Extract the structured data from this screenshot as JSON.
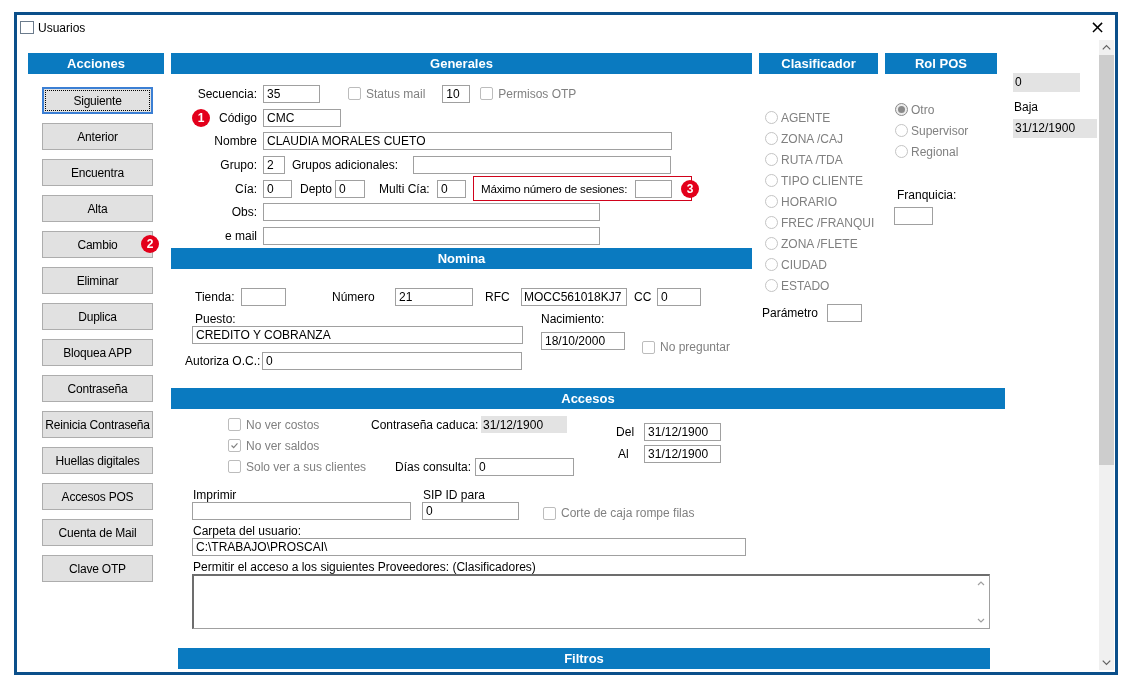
{
  "window": {
    "title": "Usuarios",
    "close": "×"
  },
  "acciones": {
    "title": "Acciones",
    "buttons": [
      {
        "label": "Siguiente",
        "focused": true
      },
      {
        "label": "Anterior",
        "focused": false
      },
      {
        "label": "Encuentra",
        "focused": false
      },
      {
        "label": "Alta",
        "focused": false
      },
      {
        "label": "Cambio",
        "focused": false,
        "callout": "2"
      },
      {
        "label": "Eliminar",
        "focused": false
      },
      {
        "label": "Duplica",
        "focused": false
      },
      {
        "label": "Bloquea APP",
        "focused": false
      },
      {
        "label": "Contraseña",
        "focused": false
      },
      {
        "label": "Reinicia Contraseña",
        "focused": false
      },
      {
        "label": "Huellas digitales",
        "focused": false
      },
      {
        "label": "Accesos POS",
        "focused": false
      },
      {
        "label": "Cuenta de Mail",
        "focused": false
      },
      {
        "label": "Clave OTP",
        "focused": false
      }
    ]
  },
  "generales": {
    "title": "Generales",
    "secuencia": {
      "label": "Secuencia:",
      "value": "35"
    },
    "status_mail": {
      "label": "Status mail",
      "checked": false,
      "disabled": true
    },
    "status_mail_value": {
      "value": "10"
    },
    "permisos_otp": {
      "label": "Permisos OTP",
      "checked": false,
      "disabled": true
    },
    "codigo": {
      "label": "Código",
      "value": "CMC",
      "callout": "1"
    },
    "nombre": {
      "label": "Nombre",
      "value": "CLAUDIA MORALES CUETO"
    },
    "grupo": {
      "label": "Grupo:",
      "value": "2"
    },
    "grupos_adicionales": {
      "label": "Grupos adicionales:"
    },
    "cia": {
      "label": "Cía:",
      "value": "0"
    },
    "depto": {
      "label": "Depto",
      "value": "0"
    },
    "multi_cia": {
      "label": "Multi Cía:",
      "value": "0"
    },
    "max_sesiones": {
      "label": "Máximo número de sesiones:",
      "highlighted": true,
      "callout": "3"
    },
    "obs": {
      "label": "Obs:"
    },
    "email": {
      "label": "e mail"
    }
  },
  "nomina": {
    "title": "Nomina",
    "tienda": {
      "label": "Tienda:"
    },
    "numero": {
      "label": "Número",
      "value": "21"
    },
    "rfc": {
      "label": "RFC",
      "value": "MOCC561018KJ7"
    },
    "cc": {
      "label": "CC",
      "value": "0"
    },
    "puesto": {
      "label": "Puesto:",
      "value": "CREDITO Y COBRANZA"
    },
    "nacimiento": {
      "label": "Nacimiento:",
      "value": "18/10/2000"
    },
    "no_preguntar": {
      "label": "No preguntar",
      "checked": false,
      "disabled": true
    },
    "autoriza": {
      "label": "Autoriza O.C.:",
      "value": "0"
    }
  },
  "clasificador": {
    "title": "Clasificador",
    "options": [
      {
        "label": "AGENTE",
        "selected": false,
        "disabled": true
      },
      {
        "label": "ZONA /CAJ",
        "selected": false,
        "disabled": true
      },
      {
        "label": "RUTA /TDA",
        "selected": false,
        "disabled": true
      },
      {
        "label": "TIPO CLIENTE",
        "selected": false,
        "disabled": true
      },
      {
        "label": "HORARIO",
        "selected": false,
        "disabled": true
      },
      {
        "label": "FREC /FRANQUI",
        "selected": false,
        "disabled": true
      },
      {
        "label": "ZONA /FLETE",
        "selected": false,
        "disabled": true
      },
      {
        "label": "CIUDAD",
        "selected": false,
        "disabled": true
      },
      {
        "label": "ESTADO",
        "selected": false,
        "disabled": true
      }
    ],
    "parametro": {
      "label": "Parámetro"
    }
  },
  "rol_pos": {
    "title": "Rol POS",
    "options": [
      {
        "label": "Otro",
        "selected": true,
        "disabled": true
      },
      {
        "label": "Supervisor",
        "selected": false,
        "disabled": true
      },
      {
        "label": "Regional",
        "selected": false,
        "disabled": true
      }
    ],
    "franquicia": {
      "label": "Franquicia:"
    }
  },
  "info": {
    "field": {
      "value": "0"
    },
    "baja": {
      "label": "Baja",
      "value": "31/12/1900"
    }
  },
  "accesos": {
    "title": "Accesos",
    "checks": [
      {
        "label": "No ver costos",
        "checked": false,
        "disabled": true
      },
      {
        "label": "No ver saldos",
        "checked": true,
        "disabled": true
      },
      {
        "label": "Solo ver a sus clientes",
        "checked": false,
        "disabled": true
      }
    ],
    "contrasena_caduca": {
      "label": "Contraseña caduca:",
      "value": "31/12/1900"
    },
    "dias_consulta": {
      "label": "Días consulta:",
      "value": "0"
    },
    "del": {
      "label": "Del",
      "value": "31/12/1900"
    },
    "al": {
      "label": "Al",
      "value": "31/12/1900"
    },
    "imprimir": {
      "label": "Imprimir"
    },
    "sip_id": {
      "label": "SIP ID para",
      "value": "0"
    },
    "corte_caja": {
      "label": "Corte de caja rompe filas",
      "checked": false,
      "disabled": true
    },
    "carpeta": {
      "label": "Carpeta del usuario:",
      "value": "C:\\TRABAJO\\PROSCAI\\"
    },
    "proveedores": {
      "label": "Permitir el acceso a los siguientes Proveedores: (Clasificadores)"
    }
  },
  "filtros": {
    "title": "Filtros"
  }
}
